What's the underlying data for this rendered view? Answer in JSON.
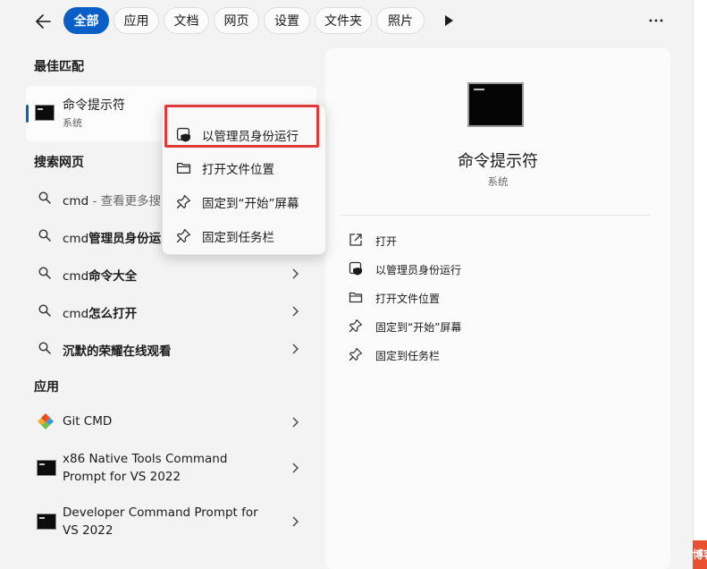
{
  "tabs": [
    "全部",
    "应用",
    "文档",
    "网页",
    "设置",
    "文件夹",
    "照片"
  ],
  "sections": {
    "best_match": "最佳匹配",
    "web_search": "搜索网页",
    "apps": "应用"
  },
  "best_match": {
    "title": "命令提示符",
    "subtitle": "系统"
  },
  "web_results": [
    {
      "prefix": "cmd",
      "suffix": " - 查看更多搜索"
    },
    {
      "prefix": "cmd",
      "suffix": "管理员身份运"
    },
    {
      "prefix": "cmd",
      "suffix": "命令大全"
    },
    {
      "prefix": "cmd",
      "suffix": "怎么打开"
    },
    {
      "prefix": "",
      "suffix": "沉默的荣耀在线观看"
    }
  ],
  "apps": [
    {
      "line1": "Git CMD",
      "line2": ""
    },
    {
      "line1": "x86 Native Tools Command",
      "line2": "Prompt for VS 2022"
    },
    {
      "line1": "Developer Command Prompt for",
      "line2": "VS 2022"
    }
  ],
  "context_menu": [
    "以管理员身份运行",
    "打开文件位置",
    "固定到“开始”屏幕",
    "固定到任务栏"
  ],
  "detail": {
    "title": "命令提示符",
    "subtitle": "系统",
    "actions": [
      "打开",
      "以管理员身份运行",
      "打开文件位置",
      "固定到“开始”屏幕",
      "固定到任务栏"
    ]
  },
  "corner_text": "博客",
  "colors": {
    "accent": "#0a5fc7",
    "highlight": "#e03a3a"
  },
  "icons": [
    "back-arrow-icon",
    "play-icon",
    "more-icon",
    "search-icon",
    "chevron-right-icon",
    "shield-icon",
    "folder-icon",
    "pin-icon",
    "open-icon",
    "cmd-icon",
    "git-icon"
  ]
}
